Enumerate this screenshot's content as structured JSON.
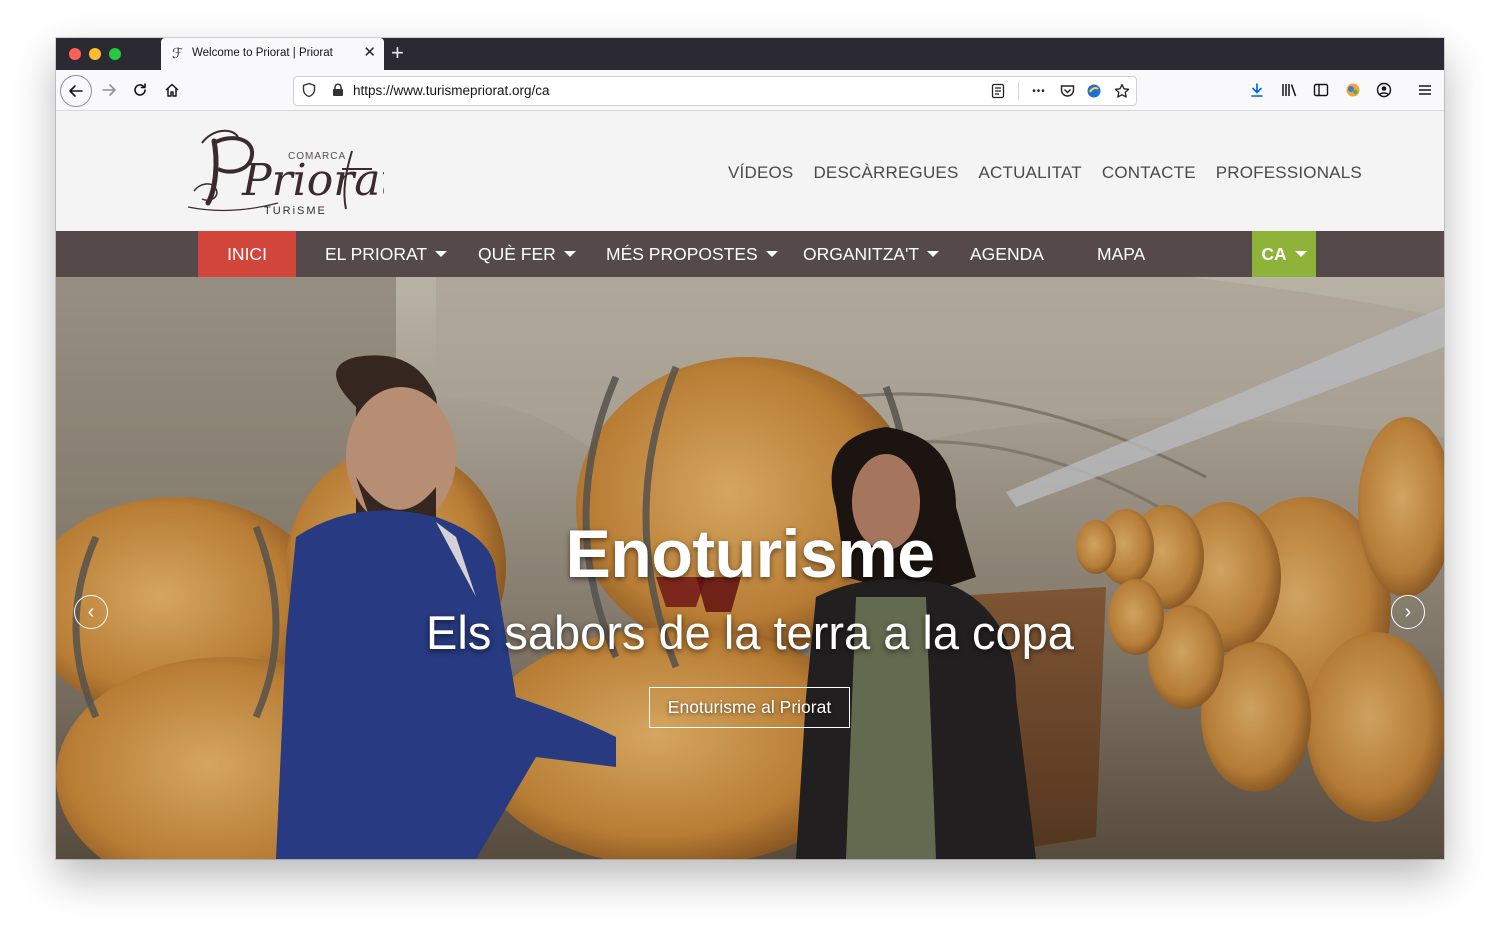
{
  "browser": {
    "tab_title": "Welcome to Priorat | Priorat",
    "new_tab_symbol": "+",
    "close_symbol": "✕",
    "url": "https://www.turismepriorat.org/ca",
    "more_symbol": "•••"
  },
  "site": {
    "logo": {
      "comarca": "COMARCA",
      "name": "Priorat",
      "turisme": "TURiSME"
    },
    "top_nav": [
      "VÍDEOS",
      "DESCÀRREGUES",
      "ACTUALITAT",
      "CONTACTE",
      "PROFESSIONALS"
    ],
    "main_nav": {
      "inici": "INICI",
      "el_priorat": "EL PRIORAT",
      "que_fer": "QUÈ FER",
      "mes_propostes": "MÉS PROPOSTES",
      "organitzat": "ORGANITZA'T",
      "agenda": "AGENDA",
      "mapa": "MAPA",
      "lang": "CA"
    },
    "hero": {
      "title": "Enoturisme",
      "subtitle": "Els sabors de la terra a la copa",
      "button": "Enoturisme al Priorat",
      "prev_symbol": "‹",
      "next_symbol": "›"
    }
  },
  "colors": {
    "nav_bg": "#55494b",
    "active_item": "#d1453b",
    "lang_bg": "#8fb339"
  }
}
